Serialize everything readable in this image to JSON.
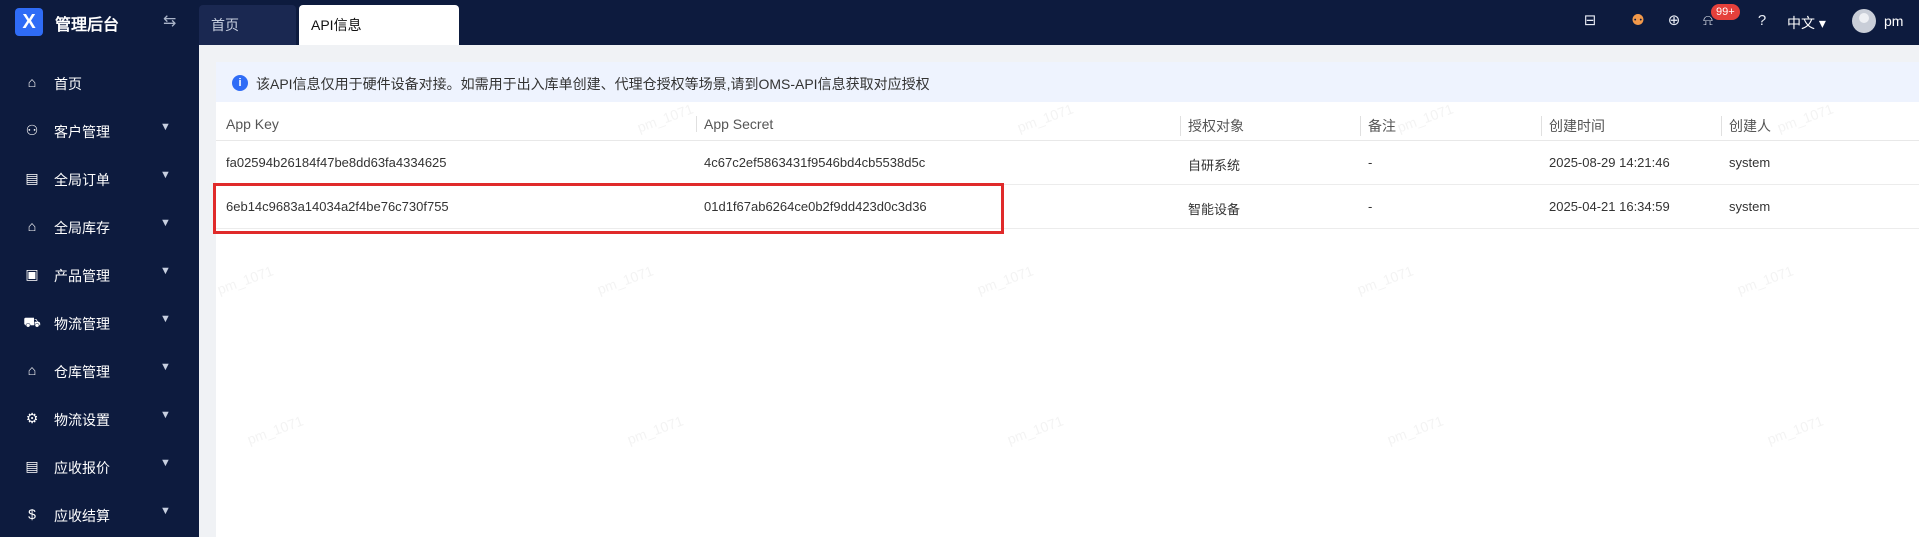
{
  "app": {
    "logo_text": "X",
    "title": "管理后台"
  },
  "tabs": [
    {
      "label": "首页"
    },
    {
      "label": "API信息"
    }
  ],
  "header": {
    "notification_badge": "99+",
    "language": "中文",
    "username": "pm"
  },
  "icons": {
    "collapse": "⇆",
    "inbox": "⊟",
    "robot": "⚉",
    "download": "⊕",
    "bell": "⍾",
    "help": "?",
    "caret": "▾"
  },
  "sidebar": {
    "items": [
      {
        "label": "首页",
        "icon": "⌂",
        "expandable": false
      },
      {
        "label": "客户管理",
        "icon": "⚇",
        "expandable": true
      },
      {
        "label": "全局订单",
        "icon": "▤",
        "expandable": true
      },
      {
        "label": "全局库存",
        "icon": "⌂",
        "expandable": true
      },
      {
        "label": "产品管理",
        "icon": "▣",
        "expandable": true
      },
      {
        "label": "物流管理",
        "icon": "⛟",
        "expandable": true
      },
      {
        "label": "仓库管理",
        "icon": "⌂",
        "expandable": true
      },
      {
        "label": "物流设置",
        "icon": "⚙",
        "expandable": true
      },
      {
        "label": "应收报价",
        "icon": "▤",
        "expandable": true
      },
      {
        "label": "应收结算",
        "icon": "$",
        "expandable": true
      }
    ]
  },
  "notice": {
    "icon": "i",
    "text": "该API信息仅用于硬件设备对接。如需用于出入库单创建、代理仓授权等场景,请到OMS-API信息获取对应授权"
  },
  "table": {
    "columns": [
      "App Key",
      "App Secret",
      "授权对象",
      "备注",
      "创建时间",
      "创建人"
    ],
    "rows": [
      [
        "fa02594b26184f47be8dd63fa4334625",
        "4c67c2ef5863431f9546bd4cb5538d5c",
        "自研系统",
        "-",
        "2025-08-29 14:21:46",
        "system"
      ],
      [
        "6eb14c9683a14034a2f4be76c730f755",
        "01d1f67ab6264ce0b2f9dd423d0c3d36",
        "智能设备",
        "-",
        "2025-04-21 16:34:59",
        "system"
      ]
    ]
  },
  "watermark": "pm_1071"
}
